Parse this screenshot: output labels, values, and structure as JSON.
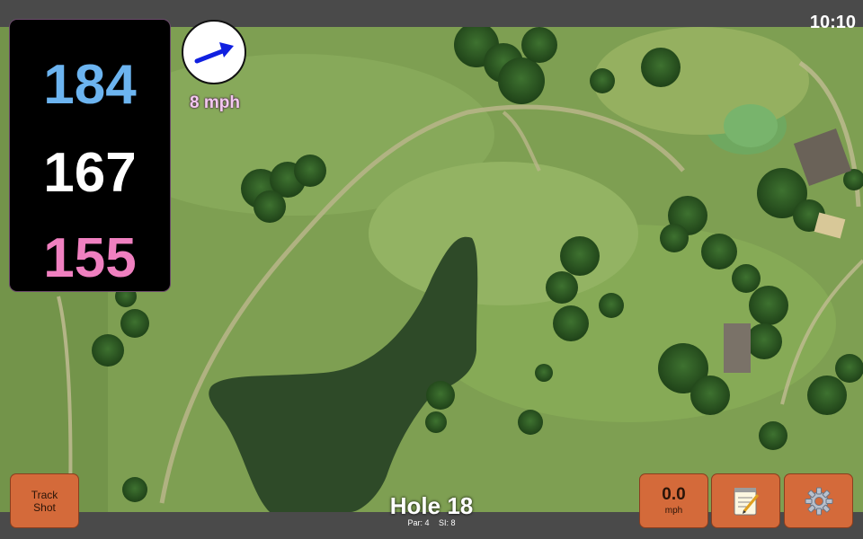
{
  "status_bar": {
    "time": "10:10"
  },
  "distances": {
    "back": "184",
    "center": "167",
    "front": "155",
    "colors": {
      "back": "#6cb4f0",
      "center": "#ffffff",
      "front": "#f080c0"
    }
  },
  "wind": {
    "speed_label": "8 mph",
    "direction_icon": "arrow-icon",
    "arrow_color": "#1020e0"
  },
  "buttons": {
    "track_shot_line1": "Track",
    "track_shot_line2": "Shot",
    "speed_value": "0.0",
    "speed_unit": "mph",
    "notes_icon": "notepad-icon",
    "settings_icon": "gear-icon",
    "button_color": "#d46a3a"
  },
  "hole": {
    "title": "Hole 18",
    "par": "Par: 4",
    "si": "SI: 8"
  },
  "map": {
    "fairway_color": "#8aa85c",
    "water_color": "#2e4a28",
    "tree_color": "#2f5a22"
  }
}
